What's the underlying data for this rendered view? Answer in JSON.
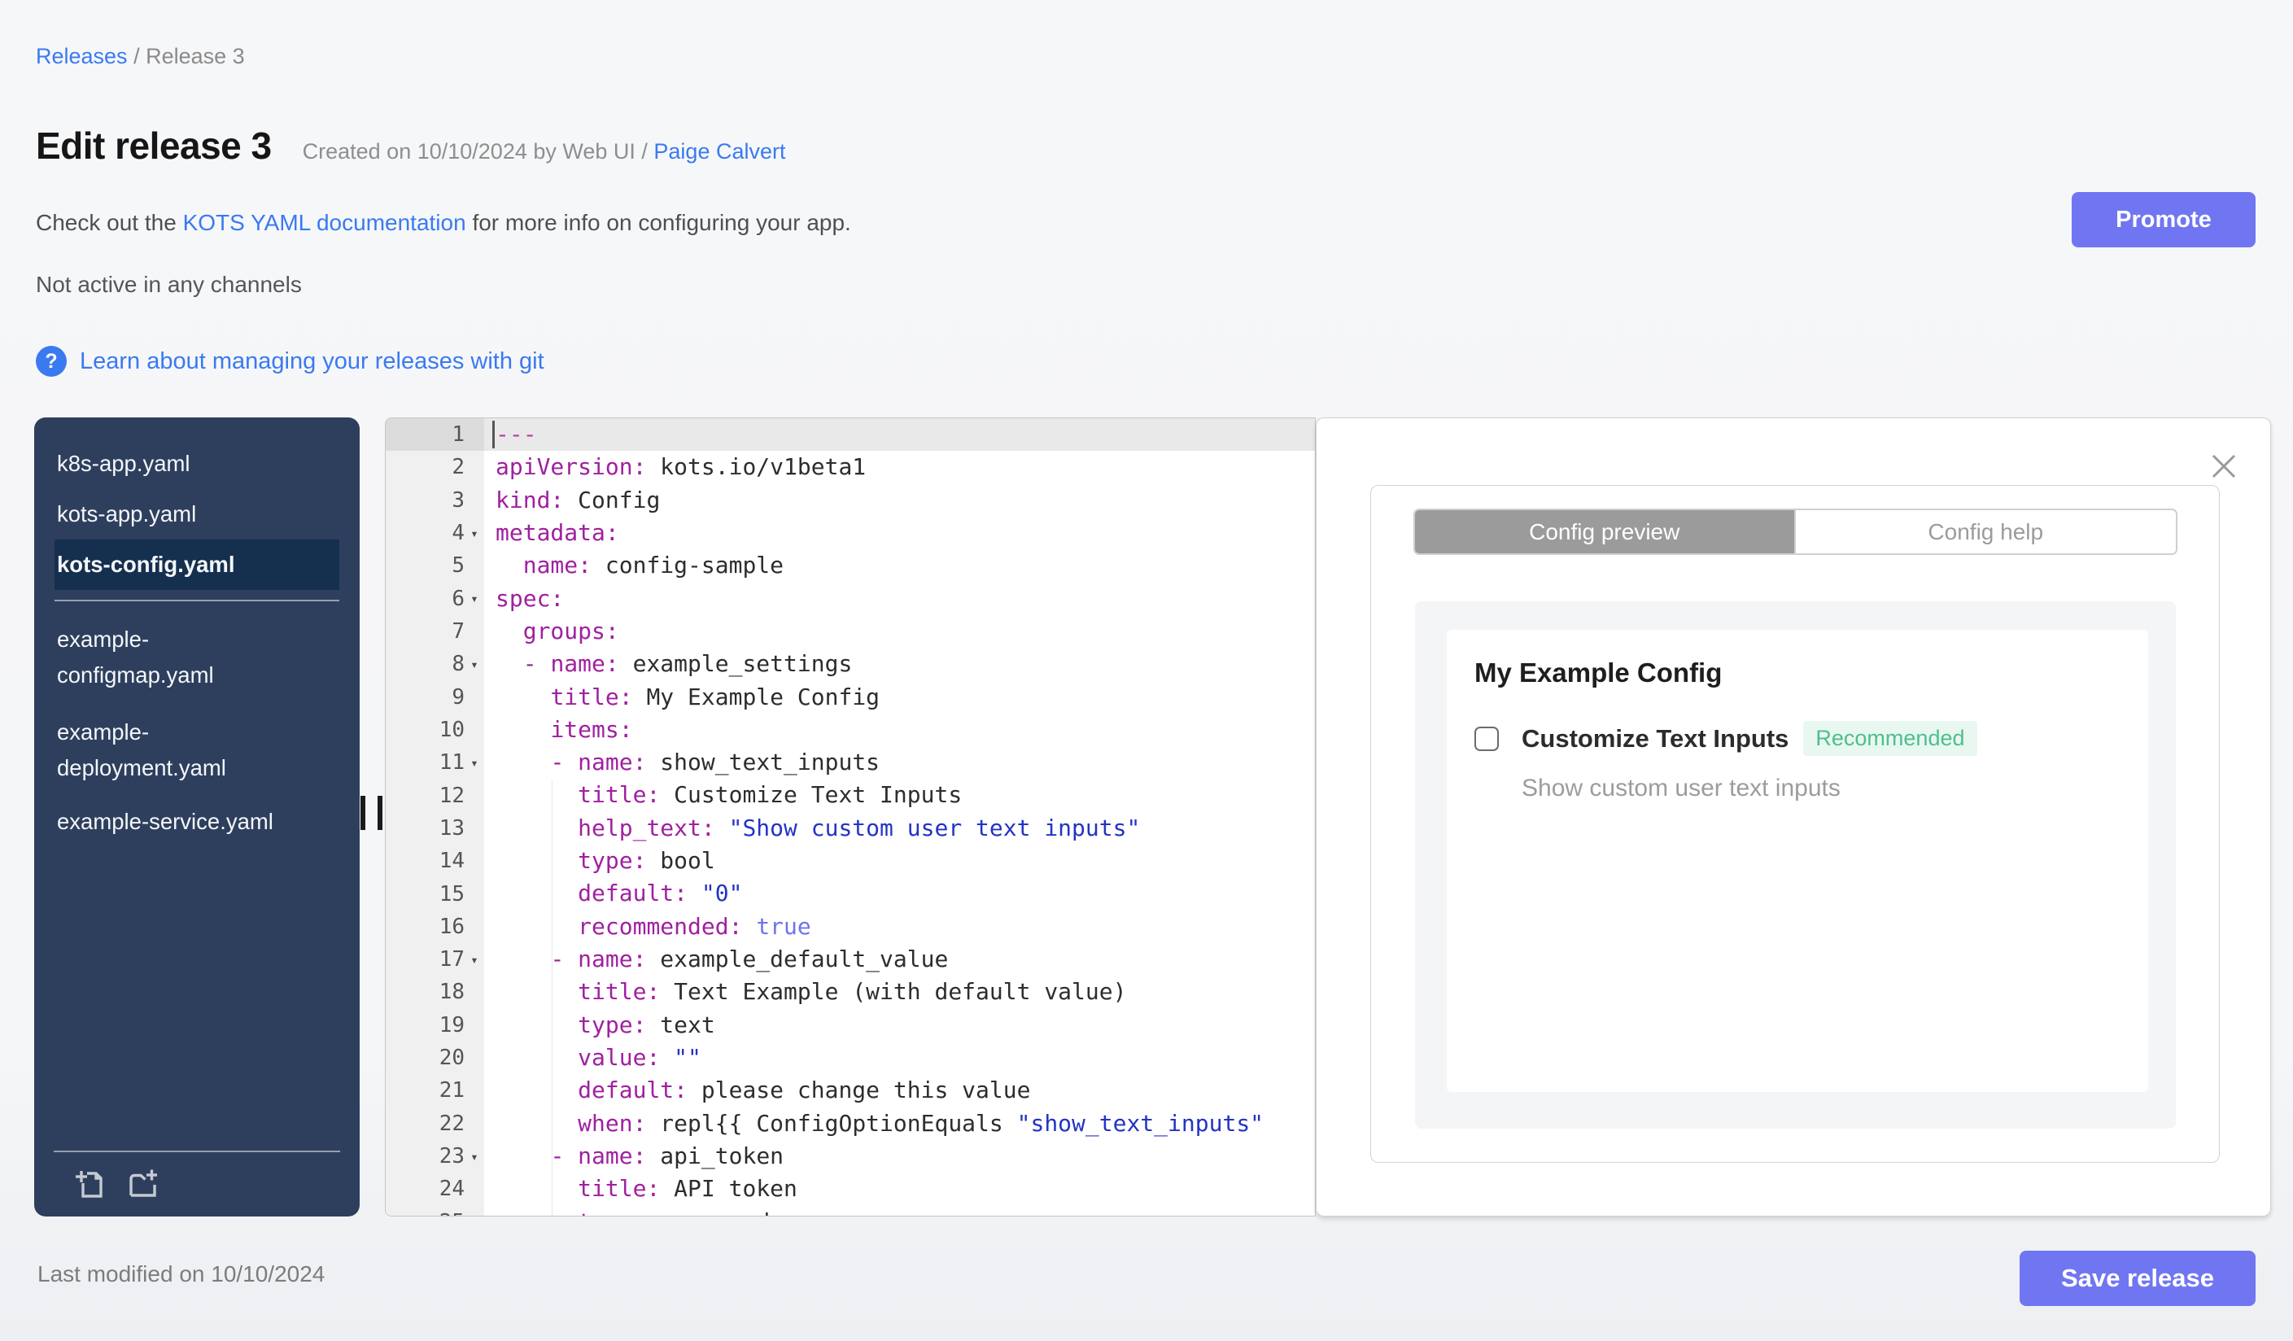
{
  "colors": {
    "accent_button": "#7076f2",
    "link_blue": "#3a7af0",
    "sidebar_navy": "#2e3f5e",
    "sidebar_selected": "#152f4e",
    "badge_green_bg": "#e8f8f0",
    "badge_green_text": "#4fbe8d",
    "tab_selected_bg": "#9b9b9b",
    "yaml_key": "#a020a0",
    "yaml_string": "#2433c4",
    "yaml_bool": "#6f74e8"
  },
  "breadcrumb": {
    "link": "Releases",
    "separator": " / ",
    "current": "Release 3"
  },
  "header": {
    "title": "Edit release 3",
    "created_text": "Created on 10/10/2024 by Web UI / ",
    "created_by_link": "Paige Calvert",
    "doc_text_before": "Check out the ",
    "doc_link": "KOTS YAML documentation",
    "doc_text_after": " for more info on configuring your app.",
    "promote_button": "Promote",
    "channel_status": "Not active in any channels",
    "help_icon_glyph": "?",
    "git_help_link": "Learn about managing your releases with git"
  },
  "sidebar": {
    "files": [
      {
        "name": "k8s-app.yaml",
        "selected": false,
        "lines": [
          "k8s-app.yaml"
        ]
      },
      {
        "name": "kots-app.yaml",
        "selected": false,
        "lines": [
          "kots-app.yaml"
        ]
      },
      {
        "name": "kots-config.yaml",
        "selected": true,
        "divider_after": true,
        "lines": [
          "kots-config.yaml"
        ]
      },
      {
        "name": "example-configmap.yaml",
        "selected": false,
        "lines": [
          "example-",
          "configmap.yaml"
        ]
      },
      {
        "name": "example-deployment.yaml",
        "selected": false,
        "lines": [
          "example-",
          "deployment.yaml"
        ]
      },
      {
        "name": "example-service.yaml",
        "selected": false,
        "lines": [
          "example-service.yaml"
        ]
      }
    ],
    "footer_icons": [
      "add-file-icon",
      "add-folder-icon"
    ]
  },
  "editor": {
    "active_line": 1,
    "fold_lines": [
      4,
      6,
      8,
      11,
      17,
      23
    ],
    "lines": [
      [
        [
          "sep",
          "---"
        ]
      ],
      [
        [
          "k",
          "apiVersion:"
        ],
        [
          "v",
          " kots.io/v1beta1"
        ]
      ],
      [
        [
          "k",
          "kind:"
        ],
        [
          "v",
          " Config"
        ]
      ],
      [
        [
          "k",
          "metadata:"
        ]
      ],
      [
        [
          "v",
          "  "
        ],
        [
          "k",
          "name:"
        ],
        [
          "v",
          " config-sample"
        ]
      ],
      [
        [
          "k",
          "spec:"
        ]
      ],
      [
        [
          "v",
          "  "
        ],
        [
          "k",
          "groups:"
        ]
      ],
      [
        [
          "v",
          "  "
        ],
        [
          "d",
          "- "
        ],
        [
          "k",
          "name:"
        ],
        [
          "v",
          " example_settings"
        ]
      ],
      [
        [
          "v",
          "    "
        ],
        [
          "k",
          "title:"
        ],
        [
          "v",
          " My Example Config"
        ]
      ],
      [
        [
          "v",
          "    "
        ],
        [
          "k",
          "items:"
        ]
      ],
      [
        [
          "v",
          "    "
        ],
        [
          "d",
          "- "
        ],
        [
          "k",
          "name:"
        ],
        [
          "v",
          " show_text_inputs"
        ]
      ],
      [
        [
          "v",
          "      "
        ],
        [
          "k",
          "title:"
        ],
        [
          "v",
          " Customize Text Inputs"
        ]
      ],
      [
        [
          "v",
          "      "
        ],
        [
          "k",
          "help_text:"
        ],
        [
          "v",
          " "
        ],
        [
          "s",
          "\"Show custom user text inputs\""
        ]
      ],
      [
        [
          "v",
          "      "
        ],
        [
          "k",
          "type:"
        ],
        [
          "v",
          " bool"
        ]
      ],
      [
        [
          "v",
          "      "
        ],
        [
          "k",
          "default:"
        ],
        [
          "v",
          " "
        ],
        [
          "s",
          "\"0\""
        ]
      ],
      [
        [
          "v",
          "      "
        ],
        [
          "k",
          "recommended:"
        ],
        [
          "v",
          " "
        ],
        [
          "b",
          "true"
        ]
      ],
      [
        [
          "v",
          "    "
        ],
        [
          "d",
          "- "
        ],
        [
          "k",
          "name:"
        ],
        [
          "v",
          " example_default_value"
        ]
      ],
      [
        [
          "v",
          "      "
        ],
        [
          "k",
          "title:"
        ],
        [
          "v",
          " Text Example (with default value)"
        ]
      ],
      [
        [
          "v",
          "      "
        ],
        [
          "k",
          "type:"
        ],
        [
          "v",
          " text"
        ]
      ],
      [
        [
          "v",
          "      "
        ],
        [
          "k",
          "value:"
        ],
        [
          "v",
          " "
        ],
        [
          "s",
          "\"\""
        ]
      ],
      [
        [
          "v",
          "      "
        ],
        [
          "k",
          "default:"
        ],
        [
          "v",
          " please change this value"
        ]
      ],
      [
        [
          "v",
          "      "
        ],
        [
          "k",
          "when:"
        ],
        [
          "v",
          " repl{{ ConfigOptionEquals "
        ],
        [
          "s",
          "\"show_text_inputs\""
        ]
      ],
      [
        [
          "v",
          "    "
        ],
        [
          "d",
          "- "
        ],
        [
          "k",
          "name:"
        ],
        [
          "v",
          " api_token"
        ]
      ],
      [
        [
          "v",
          "      "
        ],
        [
          "k",
          "title:"
        ],
        [
          "v",
          " API token"
        ]
      ],
      [
        [
          "v",
          "      "
        ],
        [
          "k",
          "type:"
        ],
        [
          "v",
          " password"
        ]
      ]
    ]
  },
  "preview_panel": {
    "tabs": [
      {
        "label": "Config preview",
        "active": true
      },
      {
        "label": "Config help",
        "active": false
      }
    ],
    "group_title": "My Example Config",
    "item": {
      "label": "Customize Text Inputs",
      "badge": "Recommended",
      "help_text": "Show custom user text inputs",
      "checked": false
    }
  },
  "footer": {
    "last_modified": "Last modified on 10/10/2024",
    "save_button": "Save release"
  }
}
